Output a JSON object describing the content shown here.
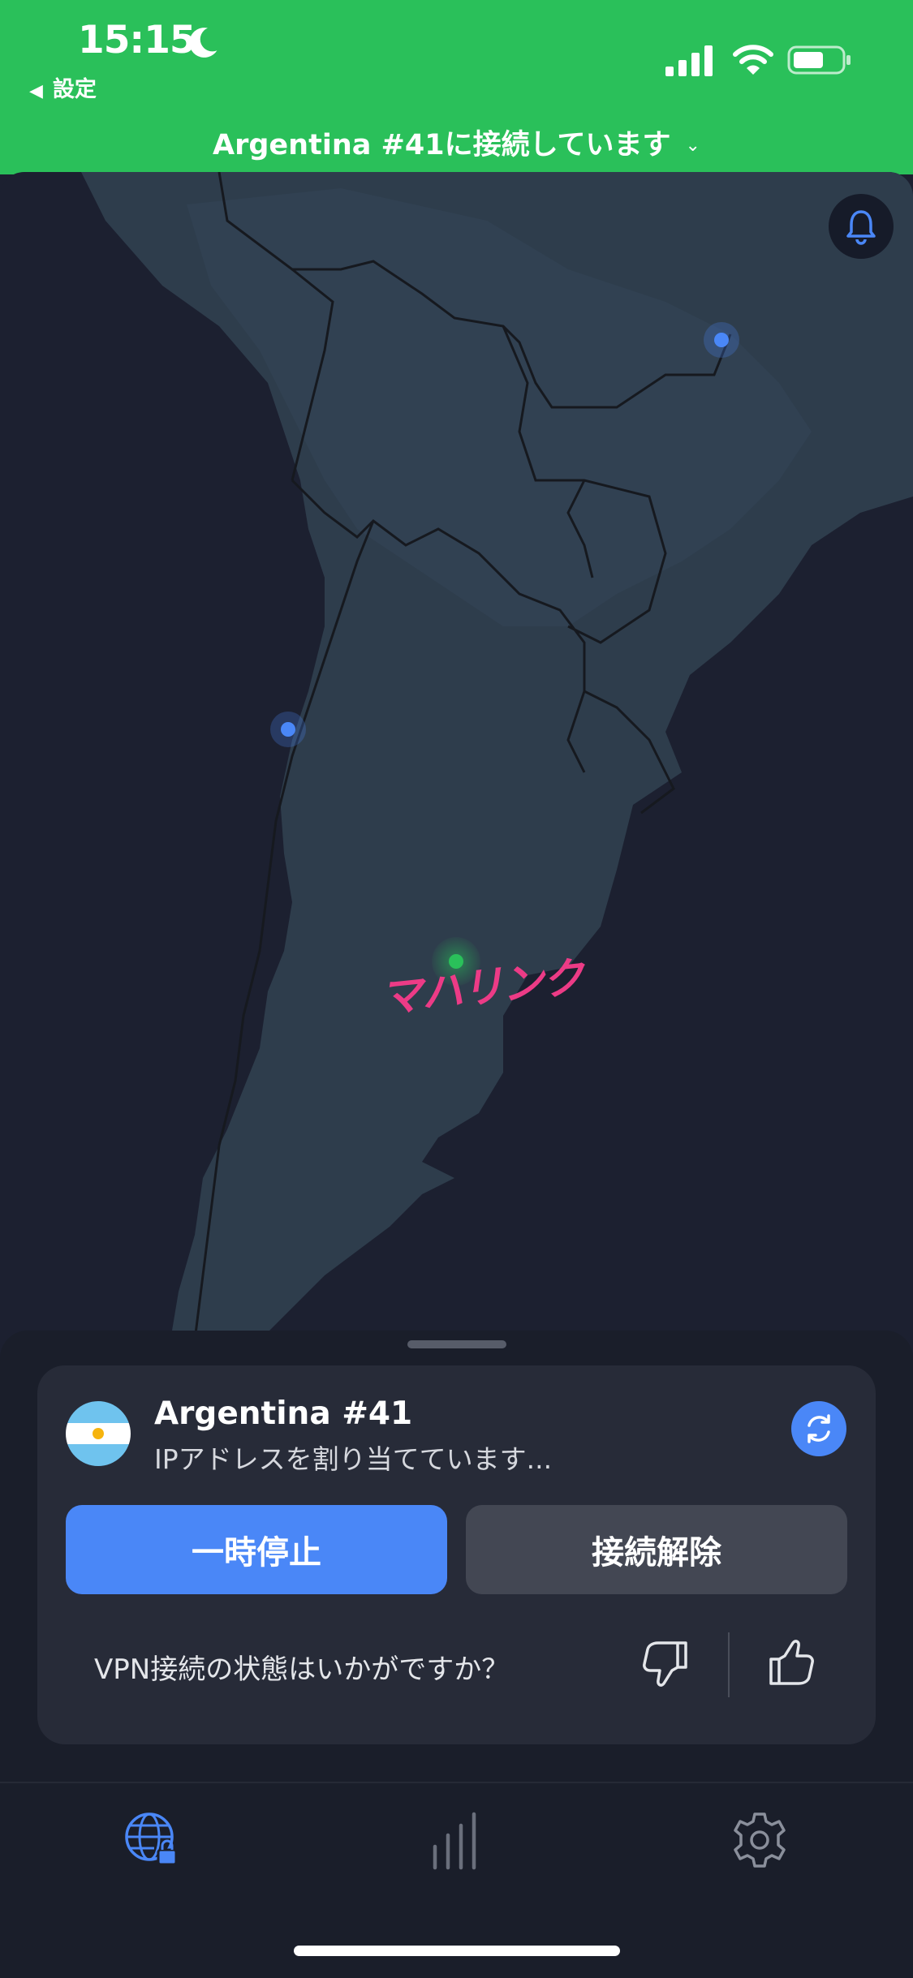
{
  "status_bar": {
    "time": "15:15",
    "back_label": "設定"
  },
  "header": {
    "connection_title": "Argentina #41に接続しています",
    "chevron": "⌄"
  },
  "map": {
    "overlay_text": "マハリンク",
    "bell_icon": "bell-icon",
    "pin_color_active": "#2ac05a",
    "pin_color_idle": "#4a87f7"
  },
  "server_card": {
    "server_name": "Argentina #41",
    "status_text": "IPアドレスを割り当てています...",
    "flag": "argentina-flag",
    "pause_label": "一時停止",
    "disconnect_label": "接続解除",
    "feedback_question": "VPN接続の状態はいかがですか？"
  },
  "tabbar": {
    "items": [
      "vpn-globe-icon",
      "stats-icon",
      "settings-icon"
    ]
  },
  "colors": {
    "accent_green": "#2ac05a",
    "accent_blue": "#4a87f7",
    "background": "#1c2030",
    "land": "#2e3d4c"
  }
}
